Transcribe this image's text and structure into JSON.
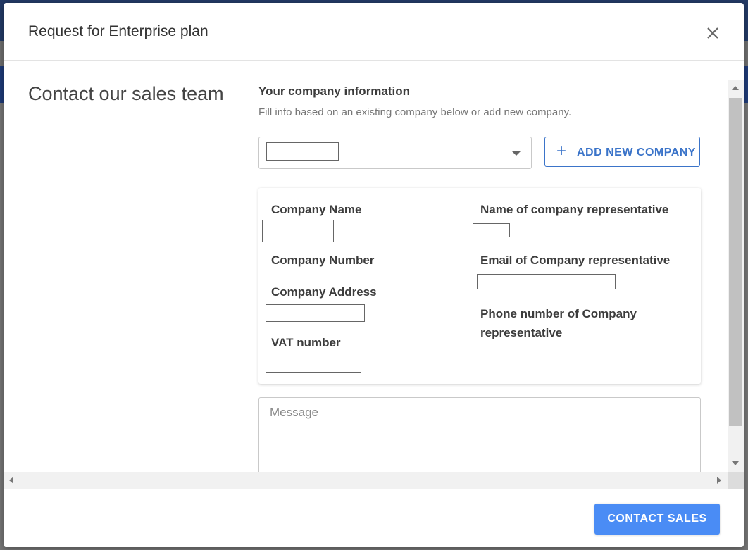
{
  "modal": {
    "title": "Request for Enterprise plan",
    "close_icon": "close-icon"
  },
  "content": {
    "section_title": "Contact our sales team",
    "company_info_title": "Your company information",
    "company_info_subtitle": "Fill info based on an existing company below or add new company.",
    "add_company_label": "ADD NEW COMPANY",
    "add_company_icon": "plus-icon",
    "select_caret_icon": "chevron-down-icon"
  },
  "form": {
    "company_name_label": "Company Name",
    "company_number_label": "Company Number",
    "company_address_label": "Company Address",
    "vat_number_label": "VAT number",
    "rep_name_label": "Name of company representative",
    "rep_email_label": "Email of Company representative",
    "rep_phone_label": "Phone number of Company representative",
    "message_placeholder": "Message"
  },
  "footer": {
    "contact_label": "CONTACT SALES"
  },
  "colors": {
    "accent": "#4a8cf5",
    "outline_accent": "#3b74c9"
  }
}
